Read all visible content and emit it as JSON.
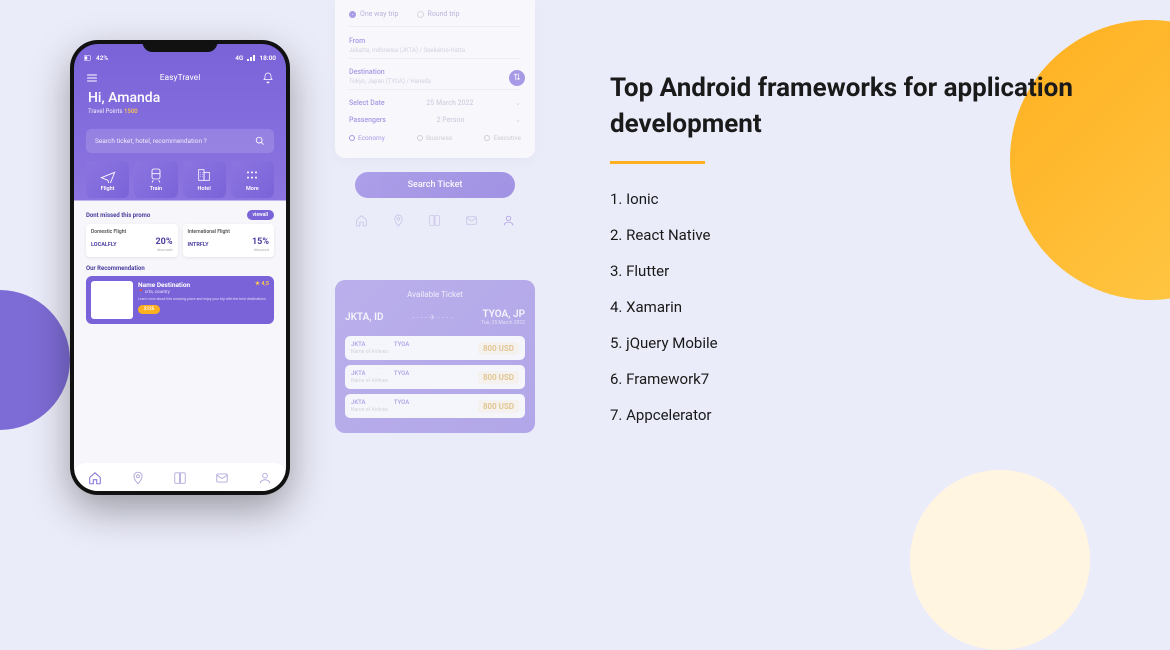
{
  "right": {
    "heading": "Top Android frameworks for application development",
    "items": [
      "1. Ionic",
      "2. React Native",
      "3. Flutter",
      "4. Xamarin",
      "5. jQuery Mobile",
      "6. Framework7",
      "7. Appcelerator"
    ]
  },
  "phone": {
    "status_left": "42%",
    "status_right": "18:00",
    "signal": "4G",
    "app_title": "EasyTravel",
    "greeting": "Hi, Amanda",
    "points_label": "Travel Points",
    "points_value": "1500",
    "search_placeholder": "Search ticket, hotel, recommendation ?",
    "categories": [
      {
        "label": "Flight",
        "icon": "plane-icon"
      },
      {
        "label": "Train",
        "icon": "train-icon"
      },
      {
        "label": "Hotel",
        "icon": "hotel-icon"
      },
      {
        "label": "More",
        "icon": "more-icon"
      }
    ],
    "promo_title": "Dont missed this promo",
    "viewall": "viewall",
    "promos": [
      {
        "title": "Domestic Flight",
        "code": "LOCALFLY",
        "discount": "20%",
        "sub": "discount"
      },
      {
        "title": "International Flight",
        "code": "INTRFLY",
        "discount": "15%",
        "sub": "discount"
      }
    ],
    "rec_title": "Our Recommendation",
    "rec_card": {
      "name": "Name Destination",
      "location": "crta, country",
      "desc": "Learn more about this amazing place and enjoy your trip with the best destinations",
      "price": "$125",
      "rating": "4,5"
    }
  },
  "form": {
    "trip_one": "One way trip",
    "trip_round": "Round trip",
    "from_label": "From",
    "from_value": "Jakarta, Indonesia (JKTA) / Soekarno-Hatta",
    "dest_label": "Destination",
    "dest_value": "Tokyo, Japan (TYOA) / Haneda",
    "date_label": "Select Date",
    "date_value": "25 March 2022",
    "pass_label": "Passengers",
    "pass_value": "2 Person",
    "class_econ": "Economy",
    "class_bus": "Business",
    "class_exec": "Executive",
    "search_btn": "Search Ticket"
  },
  "avail": {
    "title": "Available Ticket",
    "from_code": "JKTA, ID",
    "from_sub": "",
    "to_code": "TYOA, JP",
    "to_sub": "Tue, 25 March 2022",
    "tickets": [
      {
        "from": "JKTA",
        "to": "TYOA",
        "airline": "Name of Airlines",
        "price": "800 USD"
      },
      {
        "from": "JKTA",
        "to": "TYOA",
        "airline": "Name of Airlines",
        "price": "800 USD"
      },
      {
        "from": "JKTA",
        "to": "TYOA",
        "airline": "Name of Airlines",
        "price": "800 USD"
      }
    ]
  }
}
